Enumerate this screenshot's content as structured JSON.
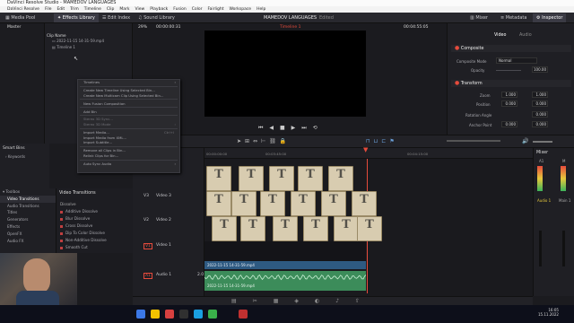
{
  "app": {
    "title": "DaVinci Resolve Studio - MAMEDOV LANGUAGES",
    "menu": [
      "DaVinci Resolve",
      "File",
      "Edit",
      "Trim",
      "Timeline",
      "Clip",
      "Mark",
      "View",
      "Playback",
      "Fusion",
      "Color",
      "Fairlight",
      "Workspace",
      "Help"
    ]
  },
  "toolbar": {
    "media_pool": "Media Pool",
    "effects_library": "Effects Library",
    "edit_index": "Edit Index",
    "sound_library": "Sound Library",
    "project_name": "MAMEDOV LANGUAGES",
    "project_status": "Edited",
    "mixer": "Mixer",
    "metadata": "Metadata",
    "inspector": "Inspector"
  },
  "media_pool": {
    "bin": "Master",
    "column_header": "Clip Name",
    "clips": [
      "2022-11-15 14-31-59.mp4",
      "Timeline 1"
    ]
  },
  "smart_bins": {
    "title": "Smart Bins",
    "item": "Keywords"
  },
  "viewer": {
    "zoom": "29%",
    "timecode_left": "00:00:00:31",
    "timeline_name": "Timeline 1",
    "timecode_right": "00:04:55:05"
  },
  "context_menu": [
    {
      "label": "Timelines",
      "dim": false,
      "arrow": true
    },
    {
      "sep": true
    },
    {
      "label": "Create New Timeline Using Selected Bin...",
      "dim": false
    },
    {
      "label": "Create New Multicam Clip Using Selected Bin...",
      "dim": false
    },
    {
      "sep": true
    },
    {
      "label": "New Fusion Composition",
      "dim": false
    },
    {
      "sep": true
    },
    {
      "label": "Add Bin",
      "dim": false
    },
    {
      "sep": true
    },
    {
      "label": "Stereo 3D Sync...",
      "dim": true
    },
    {
      "label": "Stereo 3D Mode",
      "dim": true,
      "arrow": true
    },
    {
      "sep": true
    },
    {
      "label": "Import Media...",
      "dim": false,
      "shortcut": "Ctrl+I"
    },
    {
      "label": "Import Media from XML...",
      "dim": false
    },
    {
      "label": "Import Subtitle...",
      "dim": false
    },
    {
      "sep": true
    },
    {
      "label": "Remove all Clips in Bin...",
      "dim": false
    },
    {
      "label": "Relink Clips for Bin...",
      "dim": false
    },
    {
      "sep": true
    },
    {
      "label": "Auto Sync Audio",
      "dim": false,
      "arrow": true
    }
  ],
  "toolbox": {
    "items": [
      "Toolbox",
      "Video Transitions",
      "Audio Transitions",
      "Titles",
      "Generators",
      "Effects",
      "OpenFX",
      "Audio FX"
    ]
  },
  "video_transitions": {
    "title": "Video Transitions",
    "category": "Dissolve",
    "items": [
      "Additive Dissolve",
      "Blur Dissolve",
      "Cross Dissolve",
      "Dip To Color Dissolve",
      "Non-Additive Dissolve",
      "Smooth Cut"
    ]
  },
  "inspector": {
    "tabs": [
      "Video",
      "Audio"
    ],
    "composite": {
      "title": "Composite",
      "mode_label": "Composite Mode",
      "mode_value": "Normal",
      "opacity_label": "Opacity",
      "opacity_value": "100.00"
    },
    "transform": {
      "title": "Transform",
      "zoom_label": "Zoom",
      "zoom_x": "1.000",
      "zoom_y": "1.000",
      "position_label": "Position",
      "pos_x": "0.000",
      "pos_y": "0.000",
      "rotation_label": "Rotation Angle",
      "rotation_value": "0.000",
      "anchor_label": "Anchor Point",
      "anchor_x": "0.000",
      "anchor_y": "0.000"
    }
  },
  "timeline": {
    "ruler_start": "00:00:00:00",
    "ruler_mark1": "00:03:45:00",
    "ruler_mark2": "00:04:15:00",
    "tracks": [
      {
        "id": "V3",
        "name": "Video 3"
      },
      {
        "id": "V2",
        "name": "Video 2"
      },
      {
        "id": "V1",
        "name": "Video 1"
      },
      {
        "id": "A1",
        "name": "Audio 1",
        "level": "2.0"
      }
    ],
    "title_clip_letter": "T",
    "video_clip_name": "2022-11-15 14-31-59.mp4",
    "audio_clip_name": "2022-11-15 14-31-59.mp4"
  },
  "mixer_panel": {
    "title": "Mixer",
    "channels": [
      "A1",
      "M"
    ],
    "bus_labels": [
      "Audio 1",
      "Main 1"
    ]
  },
  "taskbar": {
    "time": "16:05",
    "date": "15.11.2022"
  },
  "colors": {
    "accent": "#e64b3c",
    "audio_clip": "#3c8c5a",
    "video_clip": "#2e5a82",
    "title_clip": "#d8ccb0"
  }
}
